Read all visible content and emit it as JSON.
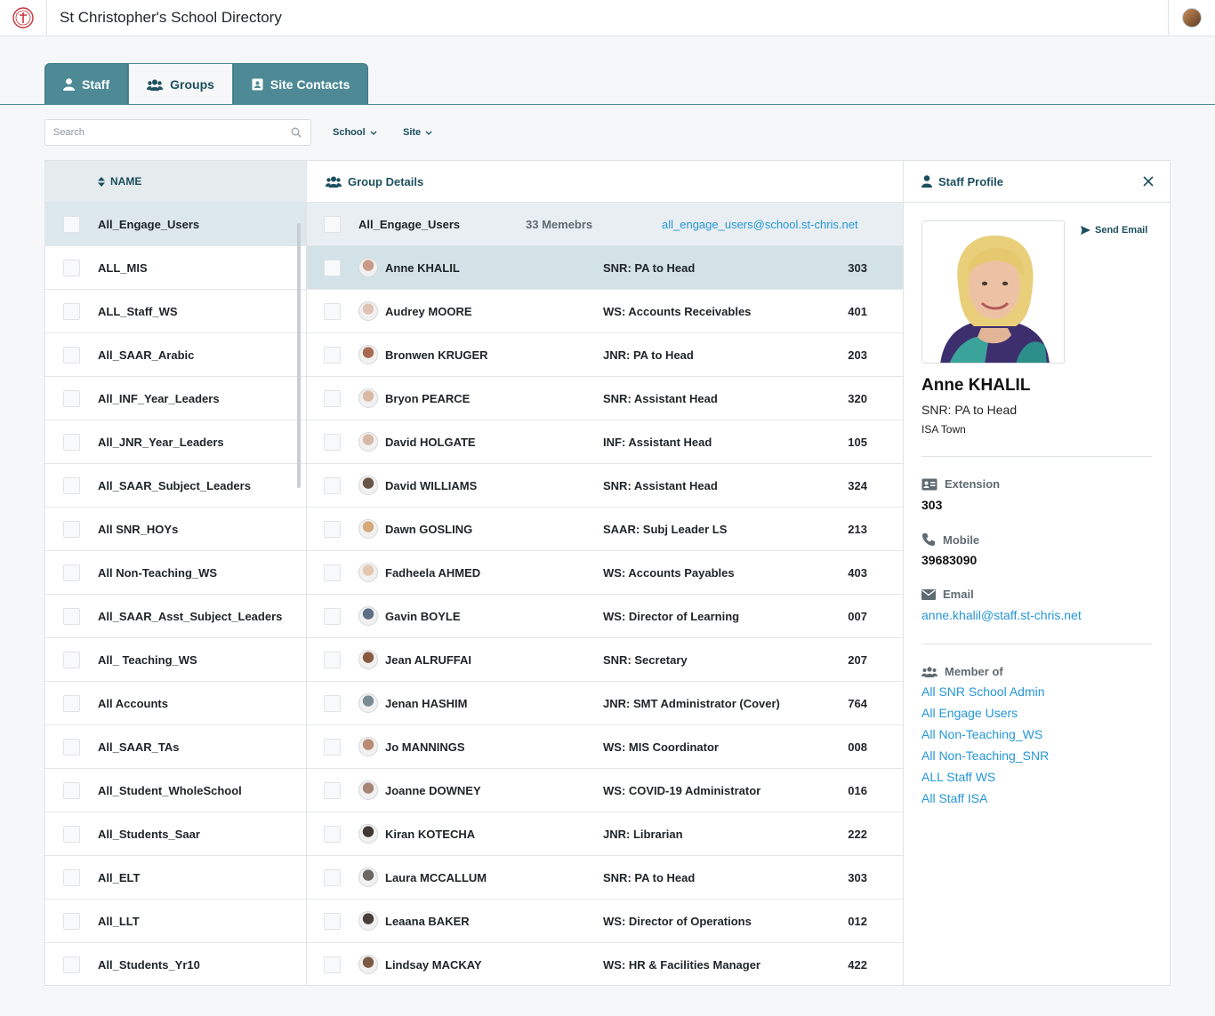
{
  "app": {
    "title": "St Christopher's School Directory"
  },
  "tabs": [
    {
      "label": "Staff",
      "icon": "person-icon",
      "active": false
    },
    {
      "label": "Groups",
      "icon": "users-icon",
      "active": true
    },
    {
      "label": "Site Contacts",
      "icon": "contact-book-icon",
      "active": false
    }
  ],
  "search": {
    "placeholder": "Search"
  },
  "filters": {
    "school": "School",
    "site": "Site"
  },
  "groups": {
    "header": "NAME",
    "items": [
      "All_Engage_Users",
      "ALL_MIS",
      "ALL_Staff_WS",
      "All_SAAR_Arabic",
      "All_INF_Year_Leaders",
      "All_JNR_Year_Leaders",
      "All_SAAR_Subject_Leaders",
      "All SNR_HOYs",
      "All Non-Teaching_WS",
      "All_SAAR_Asst_Subject_Leaders",
      "All_ Teaching_WS",
      "All Accounts",
      "All_SAAR_TAs",
      "All_Student_WholeSchool",
      "All_Students_Saar",
      "All_ELT",
      "All_LLT",
      "All_Students_Yr10"
    ],
    "selected_index": 0
  },
  "details": {
    "header": "Group Details",
    "group_name": "All_Engage_Users",
    "member_count": "33 Memebrs",
    "group_email": "all_engage_users@school.st-chris.net",
    "members": [
      {
        "name": "Anne KHALIL",
        "role": "SNR: PA to Head",
        "ext": "303"
      },
      {
        "name": "Audrey MOORE",
        "role": "WS: Accounts Receivables",
        "ext": "401"
      },
      {
        "name": "Bronwen KRUGER",
        "role": "JNR: PA to Head",
        "ext": "203"
      },
      {
        "name": "Bryon PEARCE",
        "role": "SNR: Assistant Head",
        "ext": "320"
      },
      {
        "name": "David HOLGATE",
        "role": "INF: Assistant Head",
        "ext": "105"
      },
      {
        "name": "David WILLIAMS",
        "role": "SNR: Assistant Head",
        "ext": "324"
      },
      {
        "name": "Dawn GOSLING",
        "role": "SAAR: Subj Leader LS",
        "ext": "213"
      },
      {
        "name": "Fadheela AHMED",
        "role": "WS: Accounts Payables",
        "ext": "403"
      },
      {
        "name": "Gavin BOYLE",
        "role": "WS: Director of Learning",
        "ext": "007"
      },
      {
        "name": "Jean ALRUFFAI",
        "role": "SNR: Secretary",
        "ext": "207"
      },
      {
        "name": "Jenan HASHIM",
        "role": "JNR: SMT Administrator (Cover)",
        "ext": "764"
      },
      {
        "name": "Jo MANNINGS",
        "role": "WS: MIS Coordinator",
        "ext": "008"
      },
      {
        "name": "Joanne DOWNEY",
        "role": "WS: COVID-19 Administrator",
        "ext": "016"
      },
      {
        "name": "Kiran KOTECHA",
        "role": "JNR: Librarian",
        "ext": "222"
      },
      {
        "name": "Laura MCCALLUM",
        "role": "SNR: PA to Head",
        "ext": "303"
      },
      {
        "name": "Leaana BAKER",
        "role": "WS: Director of Operations",
        "ext": "012"
      },
      {
        "name": "Lindsay MACKAY",
        "role": "WS: HR & Facilities Manager",
        "ext": "422"
      }
    ],
    "selected_index": 0
  },
  "profile": {
    "header": "Staff Profile",
    "send_email": "Send Email",
    "name": "Anne KHALIL",
    "role": "SNR: PA to Head",
    "site": "ISA Town",
    "extension_label": "Extension",
    "extension": "303",
    "mobile_label": "Mobile",
    "mobile": "39683090",
    "email_label": "Email",
    "email": "anne.khalil@staff.st-chris.net",
    "member_of_label": "Member of",
    "member_of": [
      "All SNR School Admin",
      "All Engage Users",
      "All Non-Teaching_WS",
      "All Non-Teaching_SNR",
      "ALL Staff WS",
      "All Staff ISA"
    ]
  },
  "colors": {
    "accent": "#4d8a96",
    "link": "#2596d6",
    "heading": "#1c4f5e"
  }
}
